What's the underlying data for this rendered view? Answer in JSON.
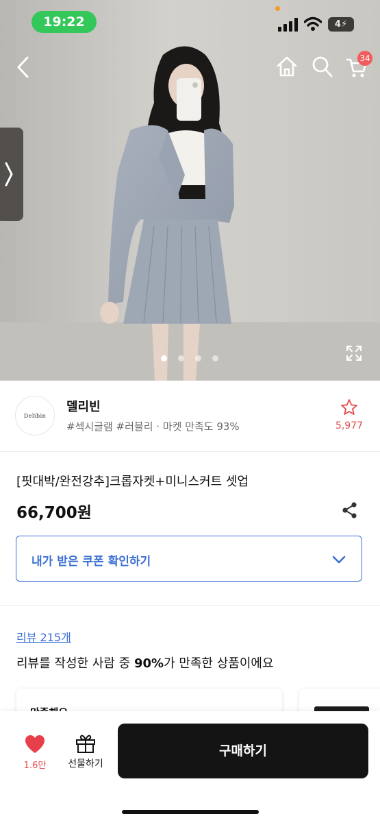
{
  "status_bar": {
    "time": "19:22",
    "battery": "4"
  },
  "hero": {
    "cart_count": "34",
    "image_count": 4,
    "active_index": 0
  },
  "seller": {
    "logo_text": "Delibin",
    "name": "델리빈",
    "tags": "#섹시글램 #러블리 · 마켓 만족도 93%",
    "favorite_count": "5,977"
  },
  "product": {
    "title": "[핏대박/완전강추]크롭자켓+미니스커트 셋업",
    "price": "66,700원"
  },
  "coupon": {
    "label": "내가 받은 쿠폰 확인하기"
  },
  "reviews": {
    "link": "리뷰 215개",
    "summary_prefix": "리뷰를 작성한 사람 중 ",
    "summary_percent": "90%",
    "summary_suffix": "가 만족한 상품이에요",
    "card_label": "만족해요"
  },
  "bottom_bar": {
    "like_count": "1.6만",
    "gift_label": "선물하기",
    "buy_label": "구매하기"
  },
  "colors": {
    "accent_blue": "#3b6fd4",
    "like_red": "#e04b4b",
    "badge_red": "#f25c5c",
    "status_green": "#34c759",
    "buy_button": "#141414"
  }
}
